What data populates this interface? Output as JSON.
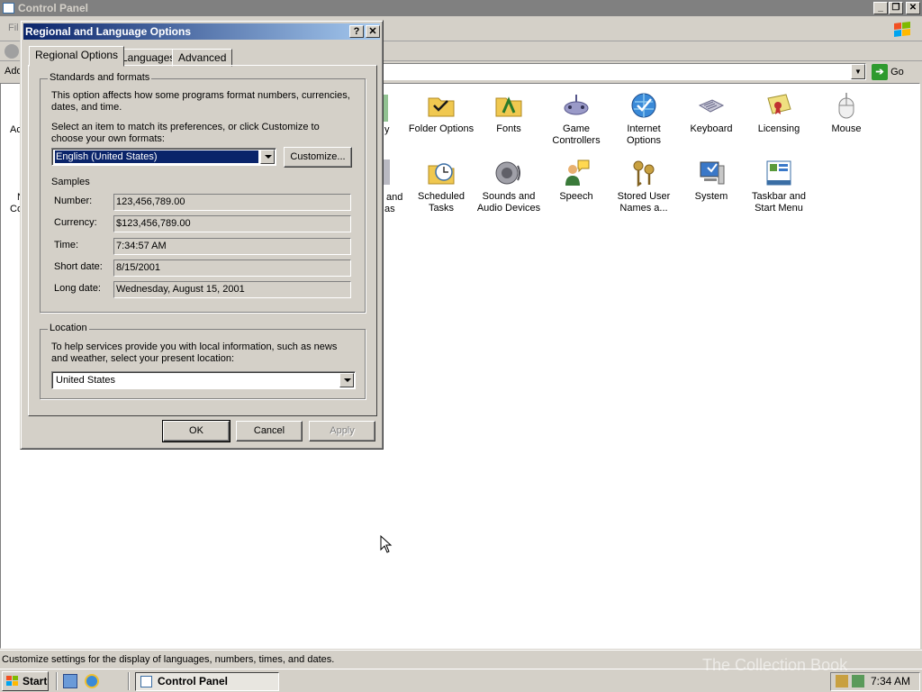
{
  "main_window": {
    "title": "Control Panel",
    "menu_partial": "Fil",
    "address_partial": "Add",
    "go_label": "Go"
  },
  "control_panel_items": [
    {
      "label": "Folder Options",
      "icon": "folder-options-icon"
    },
    {
      "label": "Fonts",
      "icon": "fonts-icon"
    },
    {
      "label": "Game Controllers",
      "icon": "game-controllers-icon"
    },
    {
      "label": "Internet Options",
      "icon": "internet-options-icon"
    },
    {
      "label": "Keyboard",
      "icon": "keyboard-icon"
    },
    {
      "label": "Licensing",
      "icon": "licensing-icon"
    },
    {
      "label": "Mouse",
      "icon": "mouse-icon"
    },
    {
      "label": "Scheduled Tasks",
      "icon": "scheduled-tasks-icon"
    },
    {
      "label": "Sounds and Audio Devices",
      "icon": "sounds-icon"
    },
    {
      "label": "Speech",
      "icon": "speech-icon"
    },
    {
      "label": "Stored User Names a...",
      "icon": "stored-user-names-icon"
    },
    {
      "label": "System",
      "icon": "system-icon"
    },
    {
      "label": "Taskbar and Start Menu",
      "icon": "taskbar-icon"
    }
  ],
  "partial_labels": {
    "left_1": "Ac",
    "left_2a": "N",
    "left_2b": "Co",
    "mid_1": "y",
    "mid_2a": "and",
    "mid_2b": "as"
  },
  "status_text": "Customize settings for the display of languages, numbers, times, and dates.",
  "taskbar": {
    "start_label": "Start",
    "task_label": "Control Panel",
    "clock": "7:34 AM"
  },
  "watermark": "The Collection Book",
  "dialog": {
    "title": "Regional and Language Options",
    "tabs": [
      "Regional Options",
      "Languages",
      "Advanced"
    ],
    "standards_group": "Standards and formats",
    "standards_desc": "This option affects how some programs format numbers, currencies, dates, and time.",
    "select_desc": "Select an item to match its preferences, or click Customize to choose your own formats:",
    "format_value": "English (United States)",
    "customize_label": "Customize...",
    "samples_label": "Samples",
    "samples": [
      {
        "label": "Number:",
        "value": "123,456,789.00"
      },
      {
        "label": "Currency:",
        "value": "$123,456,789.00"
      },
      {
        "label": "Time:",
        "value": "7:34:57 AM"
      },
      {
        "label": "Short date:",
        "value": "8/15/2001"
      },
      {
        "label": "Long date:",
        "value": "Wednesday, August 15, 2001"
      }
    ],
    "location_group": "Location",
    "location_desc": "To help services provide you with local information, such as news and weather, select your present location:",
    "location_value": "United States",
    "ok_label": "OK",
    "cancel_label": "Cancel",
    "apply_label": "Apply"
  }
}
